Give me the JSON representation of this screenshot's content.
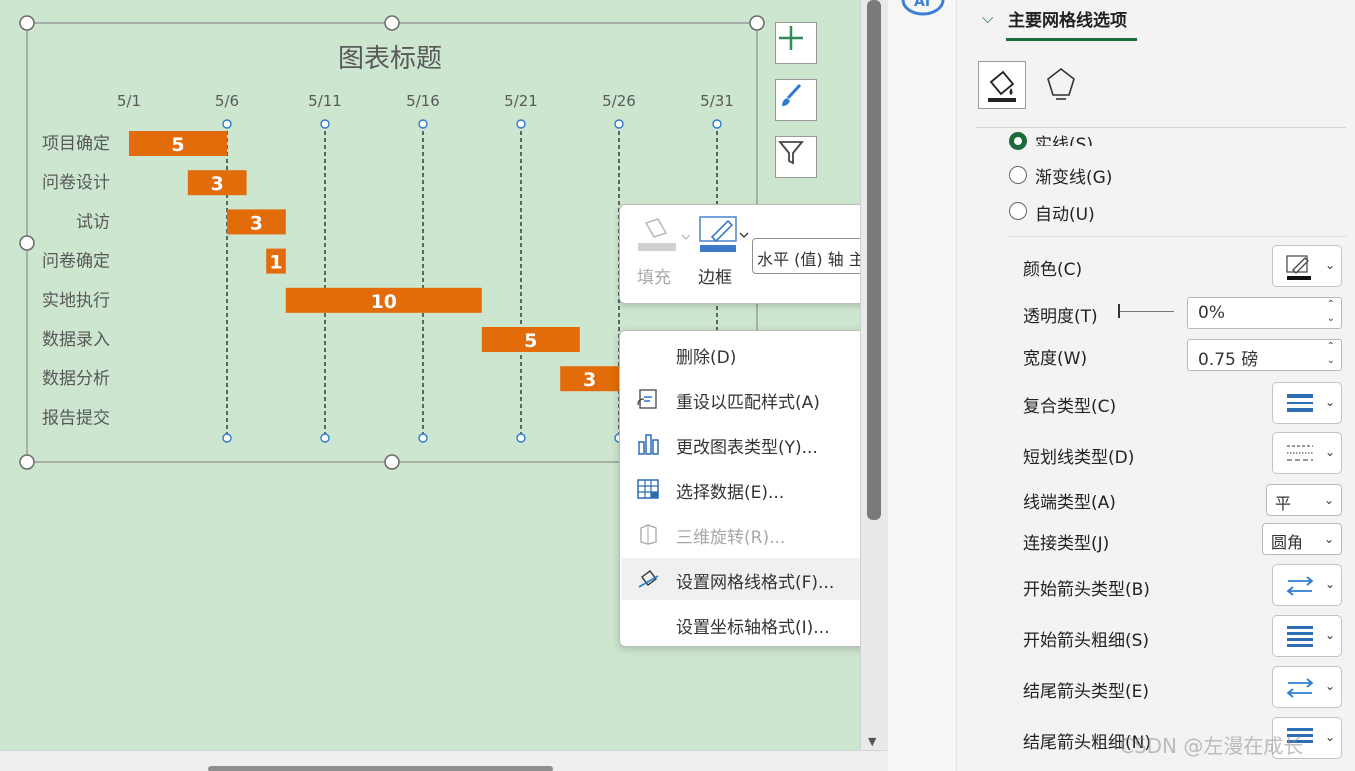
{
  "chart": {
    "title": "图表标题",
    "side_buttons": [
      "plus-icon",
      "brush-icon",
      "filter-icon"
    ]
  },
  "chart_data": {
    "type": "bar",
    "orientation": "horizontal",
    "style": "gantt",
    "title": "图表标题",
    "x_axis_position": "top",
    "x_tick_labels": [
      "5/1",
      "5/6",
      "5/11",
      "5/16",
      "5/21",
      "5/26",
      "5/31"
    ],
    "x_day_span": [
      0,
      30
    ],
    "categories": [
      "项目确定",
      "问卷设计",
      "试访",
      "问卷确定",
      "实地执行",
      "数据录入",
      "数据分析",
      "报告提交"
    ],
    "start_day": [
      0,
      3,
      5,
      7,
      8,
      18,
      22,
      null
    ],
    "duration": [
      5,
      3,
      3,
      1,
      10,
      5,
      3,
      null
    ],
    "bar_color": "#e36c0a",
    "gridlines": "vertical dashed, selected"
  },
  "mini_toolbar": {
    "fill_label": "填充",
    "border_label": "边框",
    "element_select": "水平 (值) 轴 主要"
  },
  "context_menu": {
    "items": [
      {
        "label": "删除(D)",
        "icon": "none",
        "disabled": false,
        "highlight": false
      },
      {
        "label": "重设以匹配样式(A)",
        "icon": "reset-style-icon",
        "disabled": false,
        "highlight": false
      },
      {
        "label": "更改图表类型(Y)...",
        "icon": "chart-type-icon",
        "disabled": false,
        "highlight": false
      },
      {
        "label": "选择数据(E)...",
        "icon": "select-data-icon",
        "disabled": false,
        "highlight": false
      },
      {
        "label": "三维旋转(R)...",
        "icon": "3d-rotate-icon",
        "disabled": true,
        "highlight": false
      },
      {
        "label": "设置网格线格式(F)...",
        "icon": "format-gridlines-icon",
        "disabled": false,
        "highlight": true
      },
      {
        "label": "设置坐标轴格式(I)...",
        "icon": "none",
        "disabled": false,
        "highlight": false
      }
    ]
  },
  "panel": {
    "section_title": "主要网格线选项",
    "line_options": [
      "实线(S)",
      "渐变线(G)",
      "自动(U)"
    ],
    "color_label": "颜色(C)",
    "transparency_label": "透明度(T)",
    "transparency_value": "0%",
    "width_label": "宽度(W)",
    "width_value": "0.75 磅",
    "compound_label": "复合类型(C)",
    "dash_label": "短划线类型(D)",
    "cap_label": "线端类型(A)",
    "cap_value": "平",
    "join_label": "连接类型(J)",
    "join_value": "圆角",
    "begin_arrow_type_label": "开始箭头类型(B)",
    "begin_arrow_size_label": "开始箭头粗细(S)",
    "end_arrow_type_label": "结尾箭头类型(E)",
    "end_arrow_size_label": "结尾箭头粗细(N)"
  },
  "watermark": "CSDN @左漫在成长"
}
